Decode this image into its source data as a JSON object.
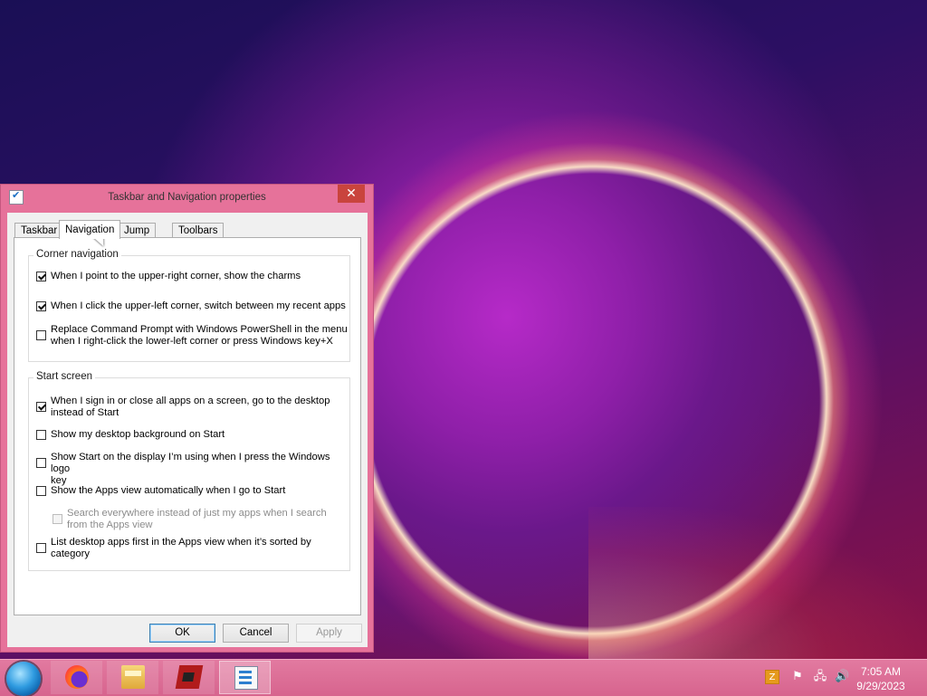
{
  "window": {
    "title": "Taskbar and Navigation properties",
    "close_glyph": "✕",
    "icon": "properties-icon"
  },
  "tabs": [
    {
      "label": "Taskbar",
      "active": false
    },
    {
      "label": "Navigation",
      "active": true
    },
    {
      "label": "Jump Lists",
      "active": false
    },
    {
      "label": "Toolbars",
      "active": false
    }
  ],
  "corner_navigation": {
    "label": "Corner navigation",
    "options": [
      {
        "line1": "When I point to the upper-right corner, show the charms",
        "line2": "",
        "checked": true,
        "enabled": true
      },
      {
        "line1": "When I click the upper-left corner, switch between my recent apps",
        "line2": "",
        "checked": true,
        "enabled": true
      },
      {
        "line1": "Replace Command Prompt with Windows PowerShell in the menu",
        "line2": "when I right-click the lower-left corner or press Windows key+X",
        "checked": false,
        "enabled": true
      }
    ]
  },
  "start_screen": {
    "label": "Start screen",
    "options": [
      {
        "line1": "When I sign in or close all apps on a screen, go to the desktop",
        "line2": "instead of Start",
        "checked": true,
        "enabled": true
      },
      {
        "line1": "Show my desktop background on Start",
        "line2": "",
        "checked": false,
        "enabled": true
      },
      {
        "line1": "Show Start on the display I’m using when I press the Windows logo",
        "line2": "key",
        "checked": false,
        "enabled": true
      },
      {
        "line1": "Show the Apps view automatically when I go to Start",
        "line2": "",
        "checked": false,
        "enabled": true
      },
      {
        "line1": "Search everywhere instead of just my apps when I search",
        "line2": "from the Apps view",
        "checked": false,
        "enabled": false
      },
      {
        "line1": "List desktop apps first in the Apps view when it’s sorted by",
        "line2": "category",
        "checked": false,
        "enabled": true
      }
    ]
  },
  "buttons": {
    "ok": "OK",
    "cancel": "Cancel",
    "apply": "Apply"
  },
  "taskbar": {
    "pinned": [
      {
        "name": "firefox-icon"
      },
      {
        "name": "file-explorer-icon"
      },
      {
        "name": "graphics-card-icon"
      },
      {
        "name": "properties-icon"
      }
    ],
    "tray_ime": "Z",
    "tray_flag": "⚑",
    "tray_network": "🖧",
    "tray_volume": "🔊"
  },
  "clock": {
    "time": "7:05 AM",
    "date": "9/29/2023"
  }
}
